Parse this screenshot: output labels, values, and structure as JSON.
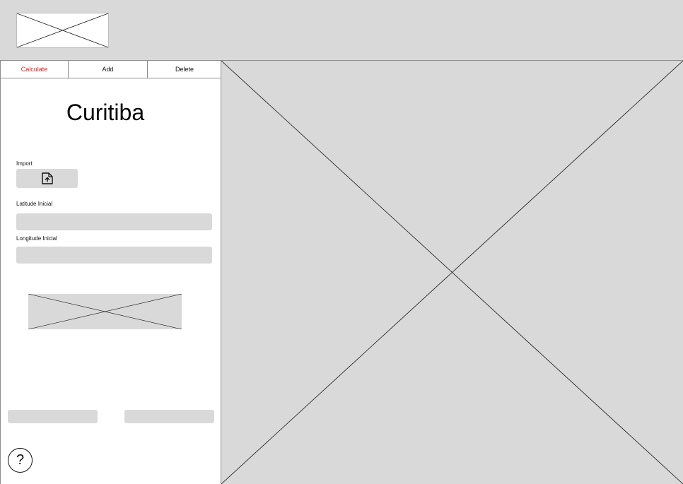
{
  "header": {
    "logo": "image-placeholder"
  },
  "tabs": [
    {
      "label": "Calculate",
      "active": true
    },
    {
      "label": "Add",
      "active": false
    },
    {
      "label": "Delete",
      "active": false
    }
  ],
  "panel": {
    "city": "Curitiba",
    "import_label": "Import",
    "import_icon": "file-upload-icon",
    "latitude_label": "Latitude Inicial",
    "latitude_value": "",
    "longitude_label": "Longitude Inicial",
    "longitude_value": "",
    "help_symbol": "?"
  },
  "colors": {
    "active_tab": "#e02020",
    "placeholder_fill": "#d9d9d9",
    "border": "#8c8c8c"
  }
}
